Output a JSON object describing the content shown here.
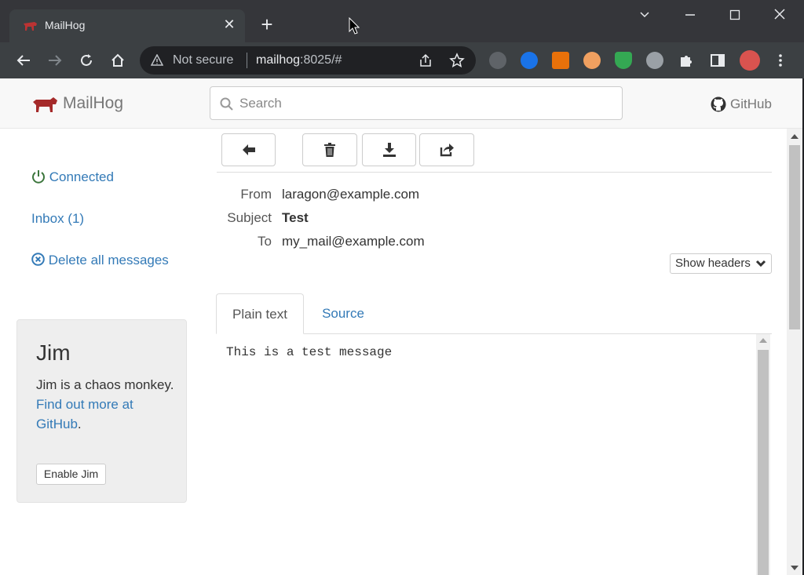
{
  "browser": {
    "tab_title": "MailHog",
    "omnibox": {
      "security_label": "Not secure",
      "url_host": "mailhog",
      "url_rest": ":8025/#"
    }
  },
  "app": {
    "brand": "MailHog",
    "search_placeholder": "Search",
    "github_label": "GitHub"
  },
  "sidebar": {
    "connected_label": "Connected",
    "inbox_label": "Inbox (1)",
    "delete_all_label": "Delete all messages",
    "jim": {
      "title": "Jim",
      "desc_prefix": "Jim is a chaos monkey.",
      "link_text": "Find out more at GitHub",
      "desc_suffix": ".",
      "button_label": "Enable Jim"
    }
  },
  "message": {
    "headers": {
      "from_label": "From",
      "from_value": "laragon@example.com",
      "subject_label": "Subject",
      "subject_value": "Test",
      "to_label": "To",
      "to_value": "my_mail@example.com"
    },
    "show_headers_label": "Show headers",
    "tabs": [
      {
        "label": "Plain text",
        "active": true
      },
      {
        "label": "Source",
        "active": false
      }
    ],
    "body": "This is a test message"
  },
  "colors": {
    "link": "#337ab7",
    "brand_red": "#a52a2a",
    "connected_green": "#3c763d"
  }
}
